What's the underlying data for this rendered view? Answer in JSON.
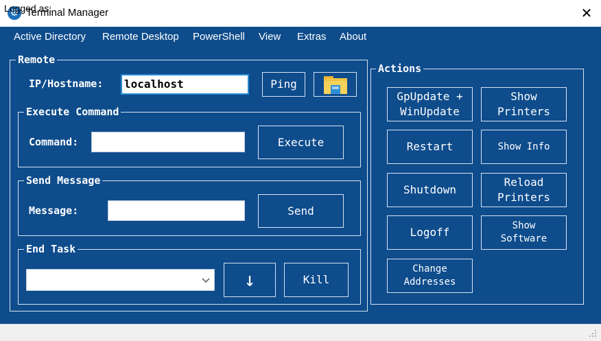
{
  "window": {
    "title": "Terminal Manager",
    "close_glyph": "✕",
    "app_icon": "⚙"
  },
  "menu": [
    "Active Directory",
    "Remote Desktop",
    "PowerShell",
    "View",
    "Extras",
    "About"
  ],
  "remote": {
    "legend": "Remote",
    "ip_label": "IP/Hostname:",
    "ip_value": "localhost",
    "ping_label": "Ping",
    "folder_icon": "folder-icon"
  },
  "execute": {
    "legend": "Execute Command",
    "label": "Command:",
    "value": "",
    "button": "Execute"
  },
  "message": {
    "legend": "Send Message",
    "label": "Message:",
    "value": "",
    "button": "Send"
  },
  "endtask": {
    "legend": "End Task",
    "selected": "",
    "down_glyph": "↓",
    "kill": "Kill"
  },
  "actions": {
    "legend": "Actions",
    "buttons": [
      "GpUpdate +\nWinUpdate",
      "Show\nPrinters",
      "Restart",
      "Show Info",
      "Shutdown",
      "Reload\nPrinters",
      "Logoff",
      "Show\nSoftware",
      "Change\nAddresses"
    ]
  },
  "status": {
    "text": "Logged as:"
  }
}
